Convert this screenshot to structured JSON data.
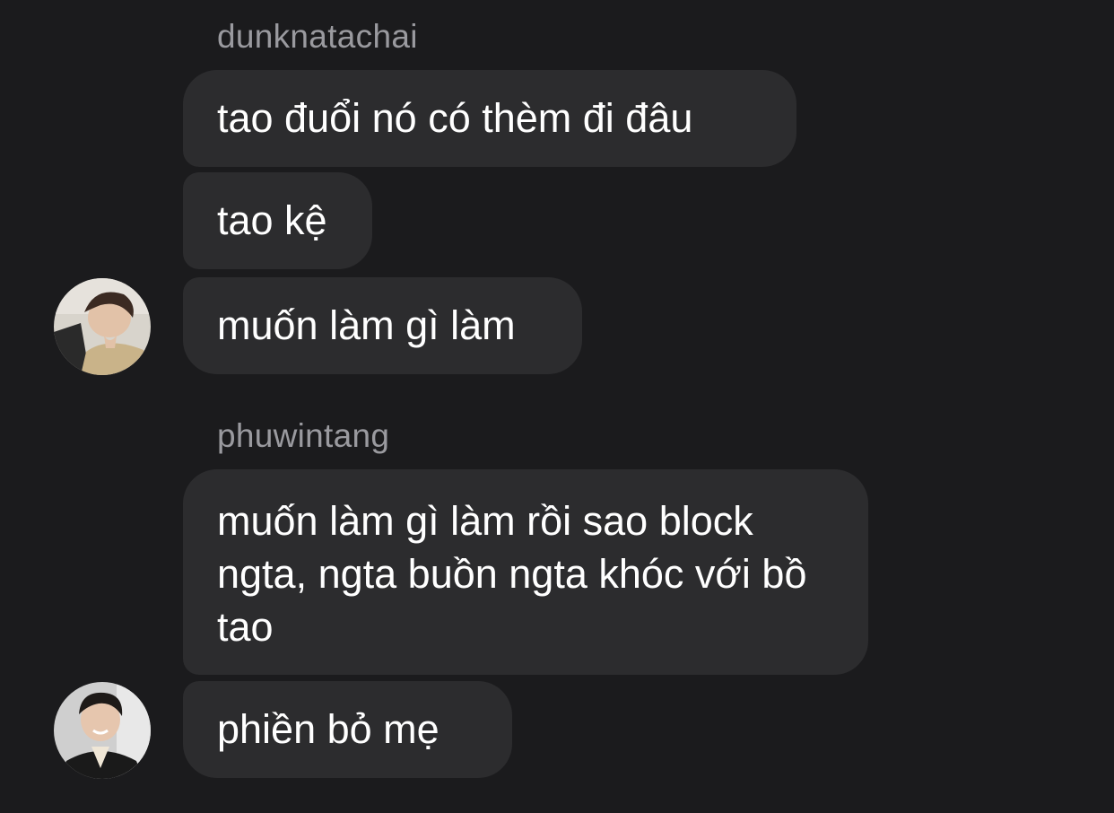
{
  "groups": [
    {
      "sender": "dunknatachai",
      "messages": [
        "tao đuổi nó có thèm đi đâu",
        "tao kệ",
        "muốn làm gì làm"
      ]
    },
    {
      "sender": "phuwintang",
      "messages": [
        "muốn làm gì làm rồi sao block ngta, ngta buồn ngta khóc với bồ tao",
        "phiền bỏ mẹ"
      ]
    }
  ]
}
